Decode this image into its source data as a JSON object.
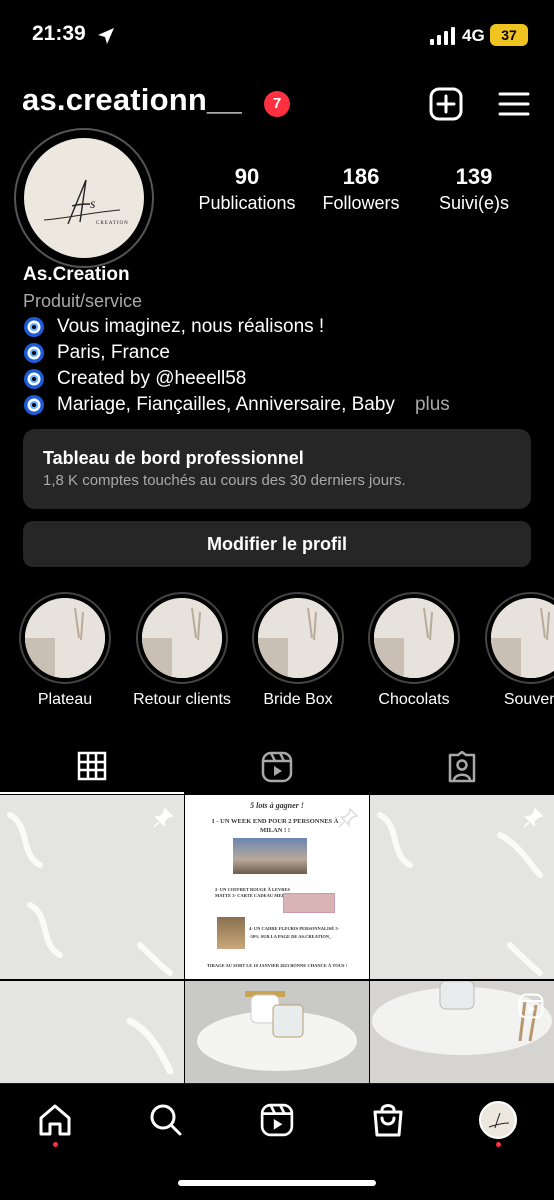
{
  "status_bar": {
    "time": "21:39",
    "network": "4G",
    "battery": "37"
  },
  "header": {
    "username": "as.creationn__",
    "notification_count": "7"
  },
  "avatar": {
    "monogram": "As",
    "sub": "CREATION"
  },
  "stats": [
    {
      "value": "90",
      "label": "Publications"
    },
    {
      "value": "186",
      "label": "Followers"
    },
    {
      "value": "139",
      "label": "Suivi(e)s"
    }
  ],
  "bio": {
    "name": "As.Creation",
    "category": "Produit/service",
    "lines": [
      "Vous imaginez, nous réalisons !",
      "Paris, France",
      "Created by @heeell58",
      "Mariage, Fiançailles, Anniversaire, Baby"
    ],
    "more": "plus"
  },
  "pro_dashboard": {
    "title": "Tableau de bord professionnel",
    "subtitle": "1,8 K comptes touchés au cours des 30 derniers jours."
  },
  "edit_profile_label": "Modifier le profil",
  "highlights": [
    "Plateau",
    "Retour clients",
    "Bride Box",
    "Chocolats",
    "Souven"
  ],
  "giveaway": {
    "title": "5 lots à gagner !",
    "prize1": "1 - UN WEEK END POUR 2 PERSONNES À MILAN ! !",
    "prize2": "2- UN COFFRET ROUGE À LEVRES MATTE 3- CARTE CADEAU MELHOR 20€",
    "prize3": "4- UN CADRE FLEURIS PERSONNALISÉ 5- -30% SUR LA PAGE DE AS.CREATION_",
    "draw": "TIRAGE AU SORT LE 10 JANVIER 2023 BONNE CHANCE À TOUS !"
  },
  "colors": {
    "accent_red": "#ff3040",
    "surface": "#262626",
    "muted": "#a8a8a8",
    "battery": "#f0c420"
  }
}
